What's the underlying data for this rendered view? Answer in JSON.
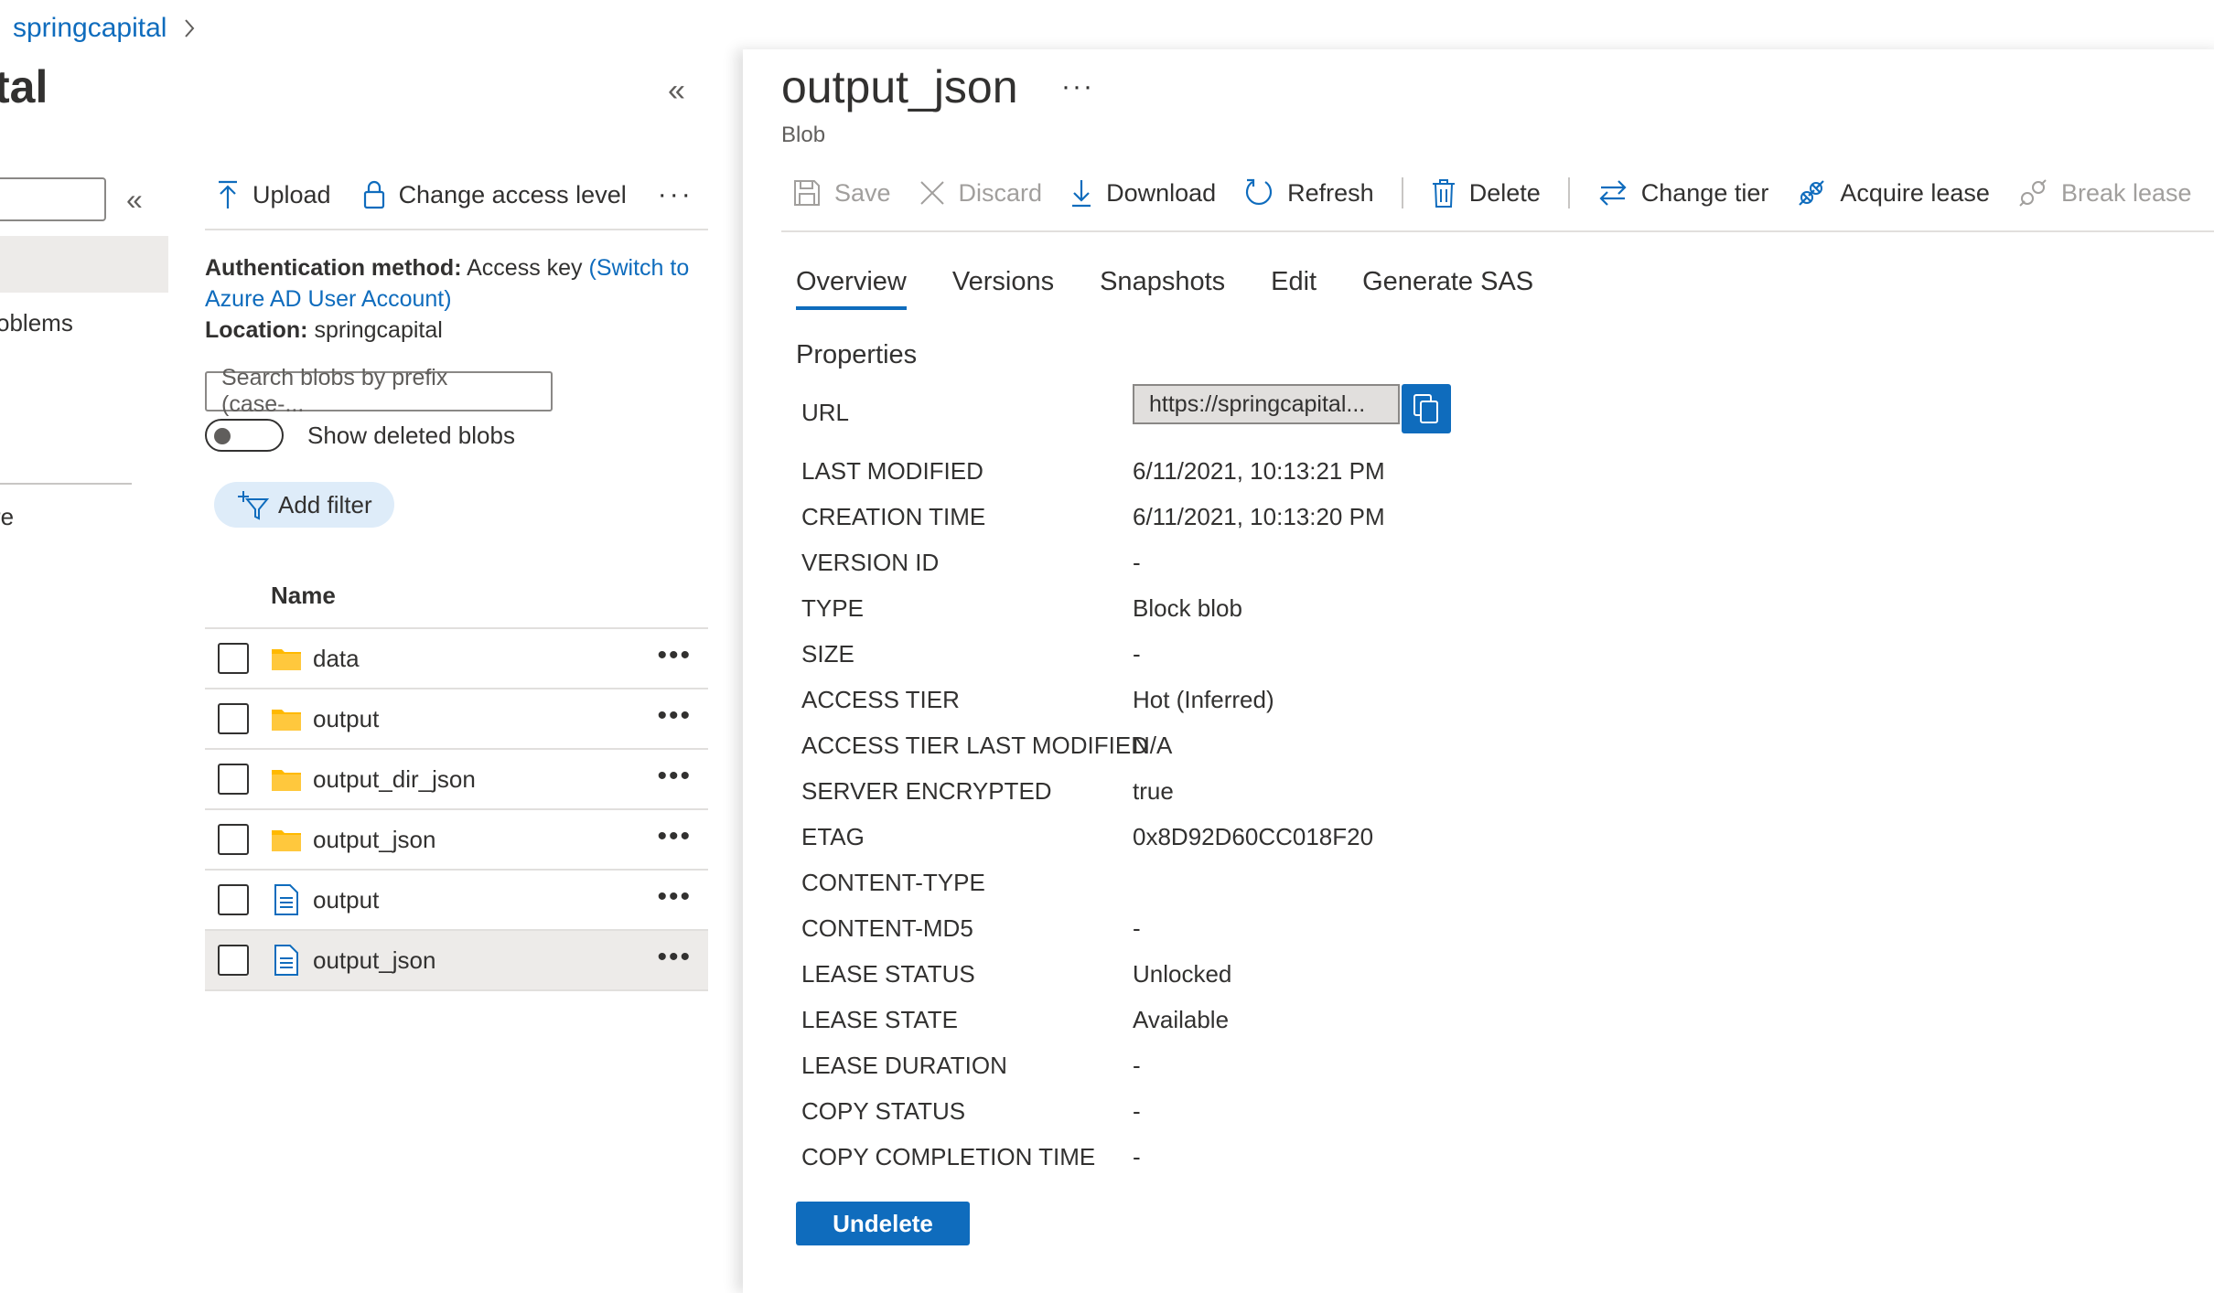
{
  "breadcrumb": {
    "item": "springcapital"
  },
  "nav": {
    "title_fragment": "tal",
    "item_problems": "oblems",
    "item_re": "re"
  },
  "container": {
    "toolbar": {
      "upload": "Upload",
      "change_access": "Change access level"
    },
    "auth": {
      "method_label": "Authentication method:",
      "method_value": "Access key",
      "switch_link": "(Switch to Azure AD User Account)",
      "location_label": "Location:",
      "location_value": "springcapital"
    },
    "search_placeholder": "Search blobs by prefix (case-...",
    "show_deleted_label": "Show deleted blobs",
    "add_filter": "Add filter",
    "name_header": "Name",
    "rows": [
      {
        "name": "data",
        "kind": "folder"
      },
      {
        "name": "output",
        "kind": "folder"
      },
      {
        "name": "output_dir_json",
        "kind": "folder"
      },
      {
        "name": "output_json",
        "kind": "folder"
      },
      {
        "name": "output",
        "kind": "file"
      },
      {
        "name": "output_json",
        "kind": "file"
      }
    ]
  },
  "blob": {
    "title": "output_json",
    "subtitle": "Blob",
    "toolbar": {
      "save": "Save",
      "discard": "Discard",
      "download": "Download",
      "refresh": "Refresh",
      "delete": "Delete",
      "change_tier": "Change tier",
      "acquire_lease": "Acquire lease",
      "break_lease": "Break lease"
    },
    "tabs": [
      "Overview",
      "Versions",
      "Snapshots",
      "Edit",
      "Generate SAS"
    ],
    "properties_heading": "Properties",
    "url_label": "URL",
    "url_value": "https://springcapital...",
    "properties": [
      {
        "key": "LAST MODIFIED",
        "value": "6/11/2021, 10:13:21 PM"
      },
      {
        "key": "CREATION TIME",
        "value": "6/11/2021, 10:13:20 PM"
      },
      {
        "key": "VERSION ID",
        "value": "-"
      },
      {
        "key": "TYPE",
        "value": "Block blob"
      },
      {
        "key": "SIZE",
        "value": "-"
      },
      {
        "key": "ACCESS TIER",
        "value": "Hot (Inferred)"
      },
      {
        "key": "ACCESS TIER LAST MODIFIED",
        "value": "N/A"
      },
      {
        "key": "SERVER ENCRYPTED",
        "value": "true"
      },
      {
        "key": "ETAG",
        "value": "0x8D92D60CC018F20"
      },
      {
        "key": "CONTENT-TYPE",
        "value": ""
      },
      {
        "key": "CONTENT-MD5",
        "value": "-"
      },
      {
        "key": "LEASE STATUS",
        "value": "Unlocked"
      },
      {
        "key": "LEASE STATE",
        "value": "Available"
      },
      {
        "key": "LEASE DURATION",
        "value": "-"
      },
      {
        "key": "COPY STATUS",
        "value": "-"
      },
      {
        "key": "COPY COMPLETION TIME",
        "value": "-"
      }
    ],
    "undelete": "Undelete"
  },
  "colors": {
    "accent": "#0f6cbd",
    "folder": "#ffb900",
    "selected_row": "#edebe9"
  }
}
